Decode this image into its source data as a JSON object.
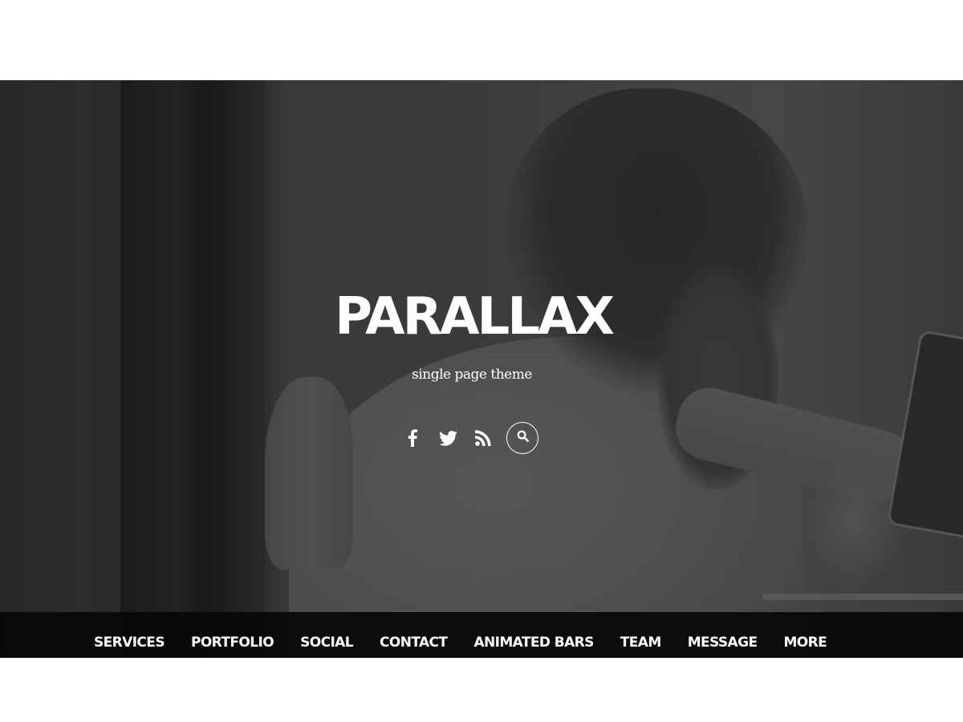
{
  "hero": {
    "title": "PARALLAX",
    "tagline": "single page theme",
    "social_icons": [
      {
        "name": "facebook-icon",
        "glyph": "f"
      },
      {
        "name": "twitter-icon",
        "glyph": "bird"
      },
      {
        "name": "rss-icon",
        "glyph": "rss"
      }
    ],
    "search_icon": "search-icon"
  },
  "nav": {
    "items": [
      {
        "label": "SERVICES"
      },
      {
        "label": "PORTFOLIO"
      },
      {
        "label": "SOCIAL"
      },
      {
        "label": "CONTACT"
      },
      {
        "label": "ANIMATED BARS"
      },
      {
        "label": "TEAM"
      },
      {
        "label": "MESSAGE"
      },
      {
        "label": "MORE"
      }
    ]
  },
  "colors": {
    "text": "#ffffff",
    "navbar": "#080808",
    "page_background": "#ffffff"
  }
}
